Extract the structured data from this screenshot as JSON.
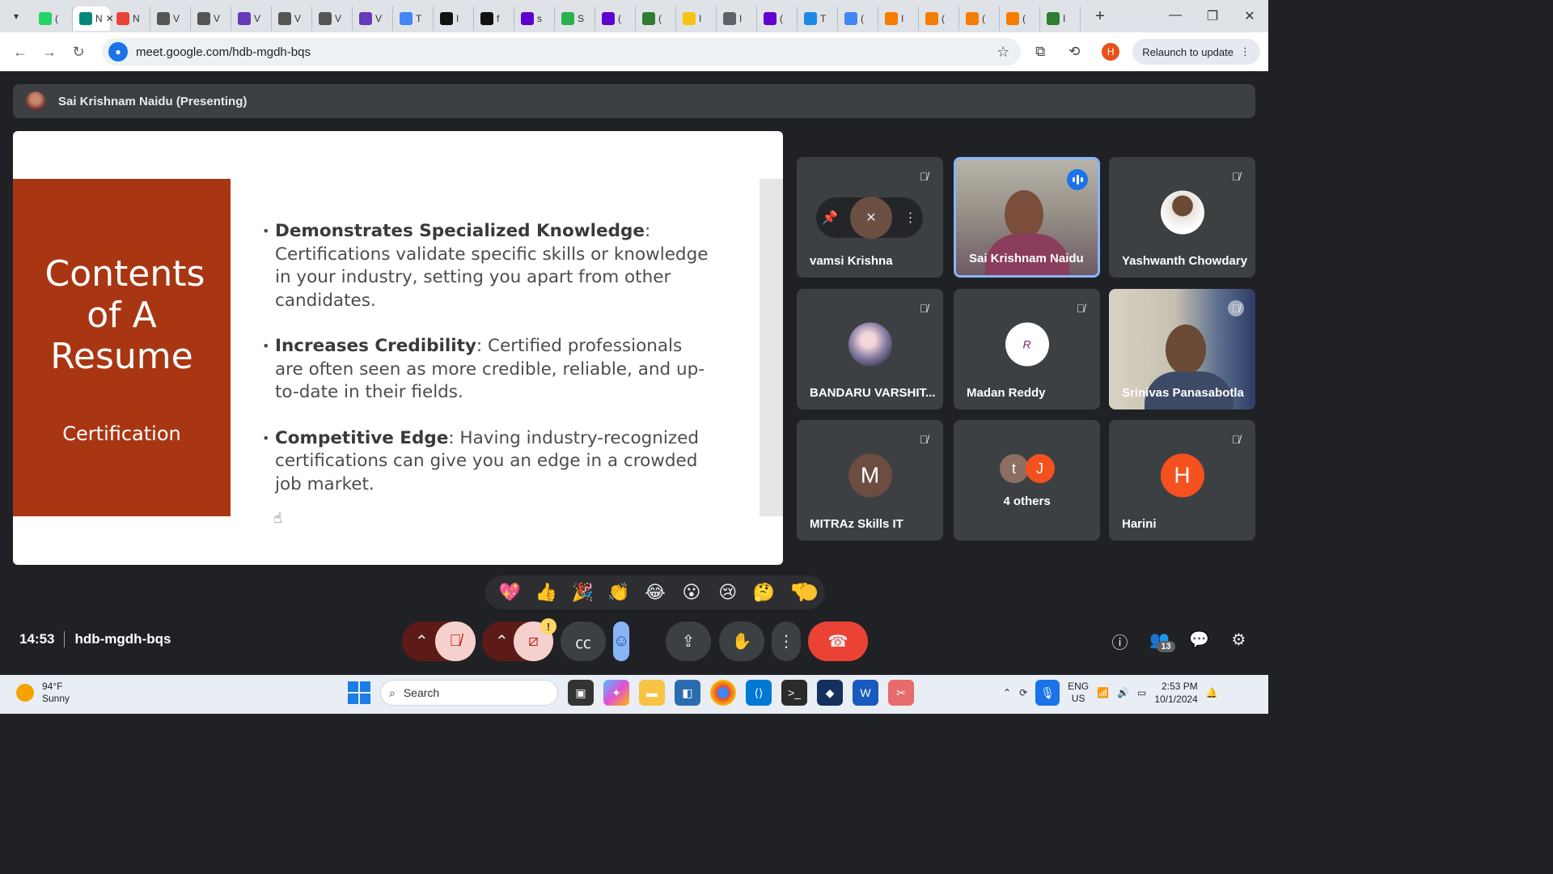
{
  "browser": {
    "tab_favicons": [
      {
        "icon": "whatsapp-icon",
        "color": "#25d366",
        "text": "("
      },
      {
        "icon": "meet-icon",
        "color": "#00897b",
        "text": "N"
      },
      {
        "icon": "gmail-icon",
        "color": "#ea4335",
        "text": "N"
      },
      {
        "icon": "avatar-icon",
        "color": "#555555",
        "text": "V"
      },
      {
        "icon": "avatar-icon",
        "color": "#555555",
        "text": "V"
      },
      {
        "icon": "forms-icon",
        "color": "#673ab7",
        "text": "V"
      },
      {
        "icon": "avatar-icon",
        "color": "#555555",
        "text": "V"
      },
      {
        "icon": "avatar-icon",
        "color": "#555555",
        "text": "V"
      },
      {
        "icon": "forms-icon",
        "color": "#673ab7",
        "text": "V"
      },
      {
        "icon": "print-icon",
        "color": "#4285f4",
        "text": "T"
      },
      {
        "icon": "hn-icon",
        "color": "#111111",
        "text": "I"
      },
      {
        "icon": "ai-icon",
        "color": "#111111",
        "text": "f"
      },
      {
        "icon": "yahoo-icon",
        "color": "#6001d2",
        "text": "s"
      },
      {
        "icon": "feedly-icon",
        "color": "#2bb24c",
        "text": "S"
      },
      {
        "icon": "yahoo-icon",
        "color": "#6001d2",
        "text": "("
      },
      {
        "icon": "link-icon",
        "color": "#2e7d32",
        "text": "("
      },
      {
        "icon": "v-icon",
        "color": "#f9c30f",
        "text": "I"
      },
      {
        "icon": "globe-icon",
        "color": "#5f6368",
        "text": "I"
      },
      {
        "icon": "yahoo-icon",
        "color": "#6001d2",
        "text": "("
      },
      {
        "icon": "c-icon",
        "color": "#1e88e5",
        "text": "T"
      },
      {
        "icon": "print-icon",
        "color": "#4285f4",
        "text": "("
      },
      {
        "icon": "ring-icon",
        "color": "#f57c00",
        "text": "I"
      },
      {
        "icon": "doc-icon",
        "color": "#f57c00",
        "text": "("
      },
      {
        "icon": "doc-icon",
        "color": "#f57c00",
        "text": "("
      },
      {
        "icon": "doc-icon",
        "color": "#f57c00",
        "text": "("
      },
      {
        "icon": "w-icon",
        "color": "#2e7d32",
        "text": "I"
      }
    ],
    "url": "meet.google.com/hdb-mgdh-bqs",
    "profile_initial": "H",
    "relaunch_label": "Relaunch to update"
  },
  "meet": {
    "presenter_label": "Sai Krishnam Naidu (Presenting)",
    "meeting_time": "14:53",
    "meeting_code": "hdb-mgdh-bqs",
    "people_count": "13"
  },
  "slide": {
    "title": "Contents of A Resume",
    "subtitle": "Certification",
    "bullets": [
      {
        "term": "Demonstrates Specialized Knowledge",
        "text": ": Certifications validate specific skills or knowledge in your industry, setting you apart from other candidates."
      },
      {
        "term": "Increases Credibility",
        "text": ": Certified professionals are often seen as more credible, reliable, and up-to-date in their fields."
      },
      {
        "term": "Competitive Edge",
        "text": ": Having industry-recognized certifications can give you an edge in a crowded job market."
      }
    ]
  },
  "participants": [
    {
      "name": "vamsi Krishna",
      "muted": true
    },
    {
      "name": "Sai Krishnam Naidu",
      "muted": false,
      "speaking": true
    },
    {
      "name": "Yashwanth Chowdary",
      "muted": true
    },
    {
      "name": "BANDARU VARSHIT...",
      "muted": true
    },
    {
      "name": "Madan Reddy",
      "muted": true
    },
    {
      "name": "Srinivas Panasabotla",
      "muted": true
    },
    {
      "name": "MITRAz Skills IT",
      "initial": "M",
      "muted": true
    },
    {
      "name": "4 others",
      "initials": [
        "t",
        "J"
      ]
    },
    {
      "name": "Harini",
      "initial": "H",
      "muted": true
    }
  ],
  "reactions": [
    "💖",
    "👍",
    "🎉",
    "👏",
    "😂",
    "😮",
    "😢",
    "🤔",
    "👎"
  ],
  "taskbar": {
    "temperature": "94°F",
    "condition": "Sunny",
    "search_placeholder": "Search",
    "lang_top": "ENG",
    "lang_bottom": "US",
    "time": "2:53 PM",
    "date": "10/1/2024"
  }
}
